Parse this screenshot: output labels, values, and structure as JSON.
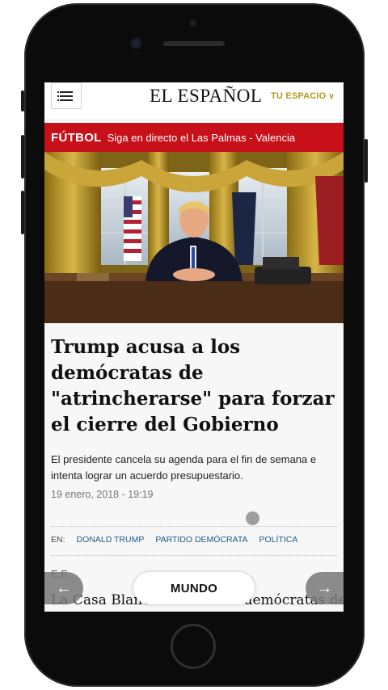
{
  "header": {
    "brand": "EL ESPAÑOL",
    "tu_espacio": "TU ESPACIO"
  },
  "ticker": {
    "tag": "FÚTBOL",
    "text": "Siga en directo el Las Palmas - Valencia"
  },
  "article": {
    "headline": "Trump acusa a los demócratas de \"atrincherarse\" para forzar el cierre del Gobierno",
    "summary": "El presidente cancela su agenda para el fin de semana e intenta lograr un acuerdo presupuestario.",
    "date": "19 enero, 2018  -  19:19",
    "tags_label": "EN:",
    "tags": [
      "DONALD TRUMP",
      "PARTIDO DEMÓCRATA",
      "POLÍTICA"
    ],
    "source": "E.E.",
    "body_start": "La Casa Blanca acusó a los demócratas de"
  },
  "bottom_nav": {
    "section": "MUNDO",
    "prev_icon": "arrow-left-icon",
    "next_icon": "arrow-right-icon"
  },
  "colors": {
    "ticker_bg": "#c8101a",
    "accent_gold": "#b39a1e",
    "tag_link": "#1c5a8a"
  }
}
